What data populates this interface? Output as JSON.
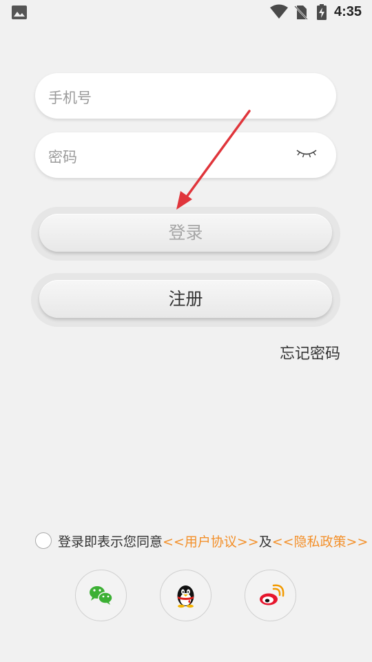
{
  "status_bar": {
    "time": "4:35",
    "icons": [
      "gallery-icon",
      "wifi-icon",
      "no-sim-icon",
      "battery-charging-icon"
    ]
  },
  "form": {
    "phone_placeholder": "手机号",
    "password_placeholder": "密码",
    "password_toggle_icon": "eye-closed-icon"
  },
  "buttons": {
    "login_label": "登录",
    "register_label": "注册"
  },
  "forgot_password_label": "忘记密码",
  "agreement": {
    "prefix": "登录即表示您同意",
    "user_agreement": "<<用户协议>>",
    "conjunction": "及",
    "privacy_policy": "<<隐私政策>>",
    "checked": false
  },
  "social_login": [
    {
      "name": "wechat",
      "icon": "wechat-icon"
    },
    {
      "name": "qq",
      "icon": "qq-icon"
    },
    {
      "name": "weibo",
      "icon": "weibo-icon"
    }
  ],
  "colors": {
    "background": "#f1f1f1",
    "link": "#f3902a",
    "annotation_arrow": "#e0353b",
    "wechat_green": "#3cb034"
  },
  "annotation": {
    "type": "arrow",
    "points_to": "login-button"
  }
}
